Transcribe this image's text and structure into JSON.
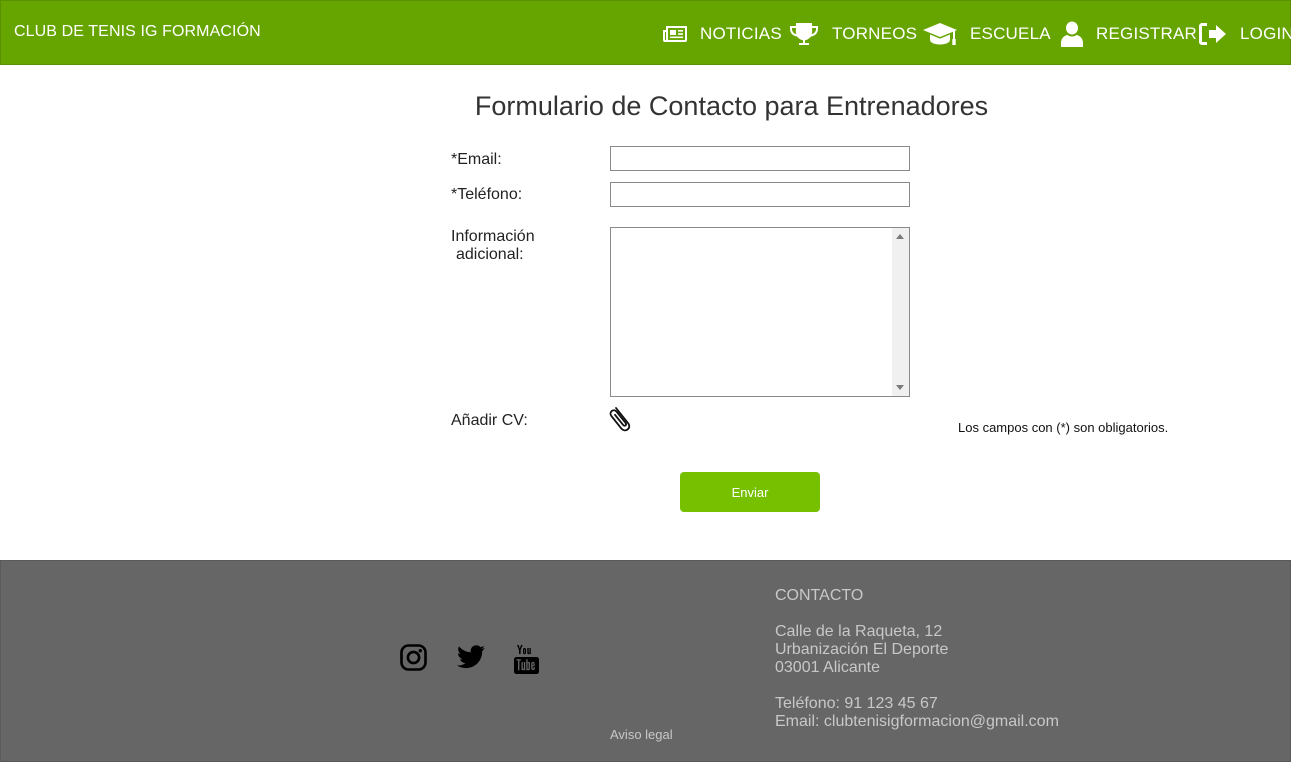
{
  "header": {
    "brand": "CLUB DE TENIS IG FORMACIÓN",
    "nav": [
      {
        "label": "NOTICIAS",
        "icon": "newspaper-icon"
      },
      {
        "label": "TORNEOS",
        "icon": "trophy-icon"
      },
      {
        "label": "ESCUELA",
        "icon": "graduation-cap-icon"
      },
      {
        "label": "REGISTRAR",
        "icon": "user-icon"
      },
      {
        "label": "LOGIN",
        "icon": "sign-in-icon"
      }
    ]
  },
  "form": {
    "title": "Formulario de Contacto para Entrenadores",
    "email_label": "*Email:",
    "email_value": "",
    "phone_label": "*Teléfono:",
    "phone_value": "",
    "info_label_line1": "Información",
    "info_label_line2": "adicional:",
    "info_value": "",
    "cv_label": "Añadir CV:",
    "cv_icon": "paperclip-icon",
    "required_note": "Los campos con (*) son obligatorios.",
    "submit_label": "Enviar"
  },
  "footer": {
    "social": [
      "instagram-icon",
      "twitter-icon",
      "youtube-icon"
    ],
    "aviso_legal": "Aviso legal",
    "contact_title": "CONTACTO",
    "address_line1": "Calle de la Raqueta, 12",
    "address_line2": "Urbanización El Deporte",
    "address_line3": "03001 Alicante",
    "phone": "Teléfono: 91 123 45 67",
    "email": "Email: clubtenisigformacion@gmail.com"
  },
  "colors": {
    "header_bg": "#66a500",
    "button_bg": "#76c000",
    "footer_bg": "#666666",
    "footer_text": "#c8c8c8"
  }
}
